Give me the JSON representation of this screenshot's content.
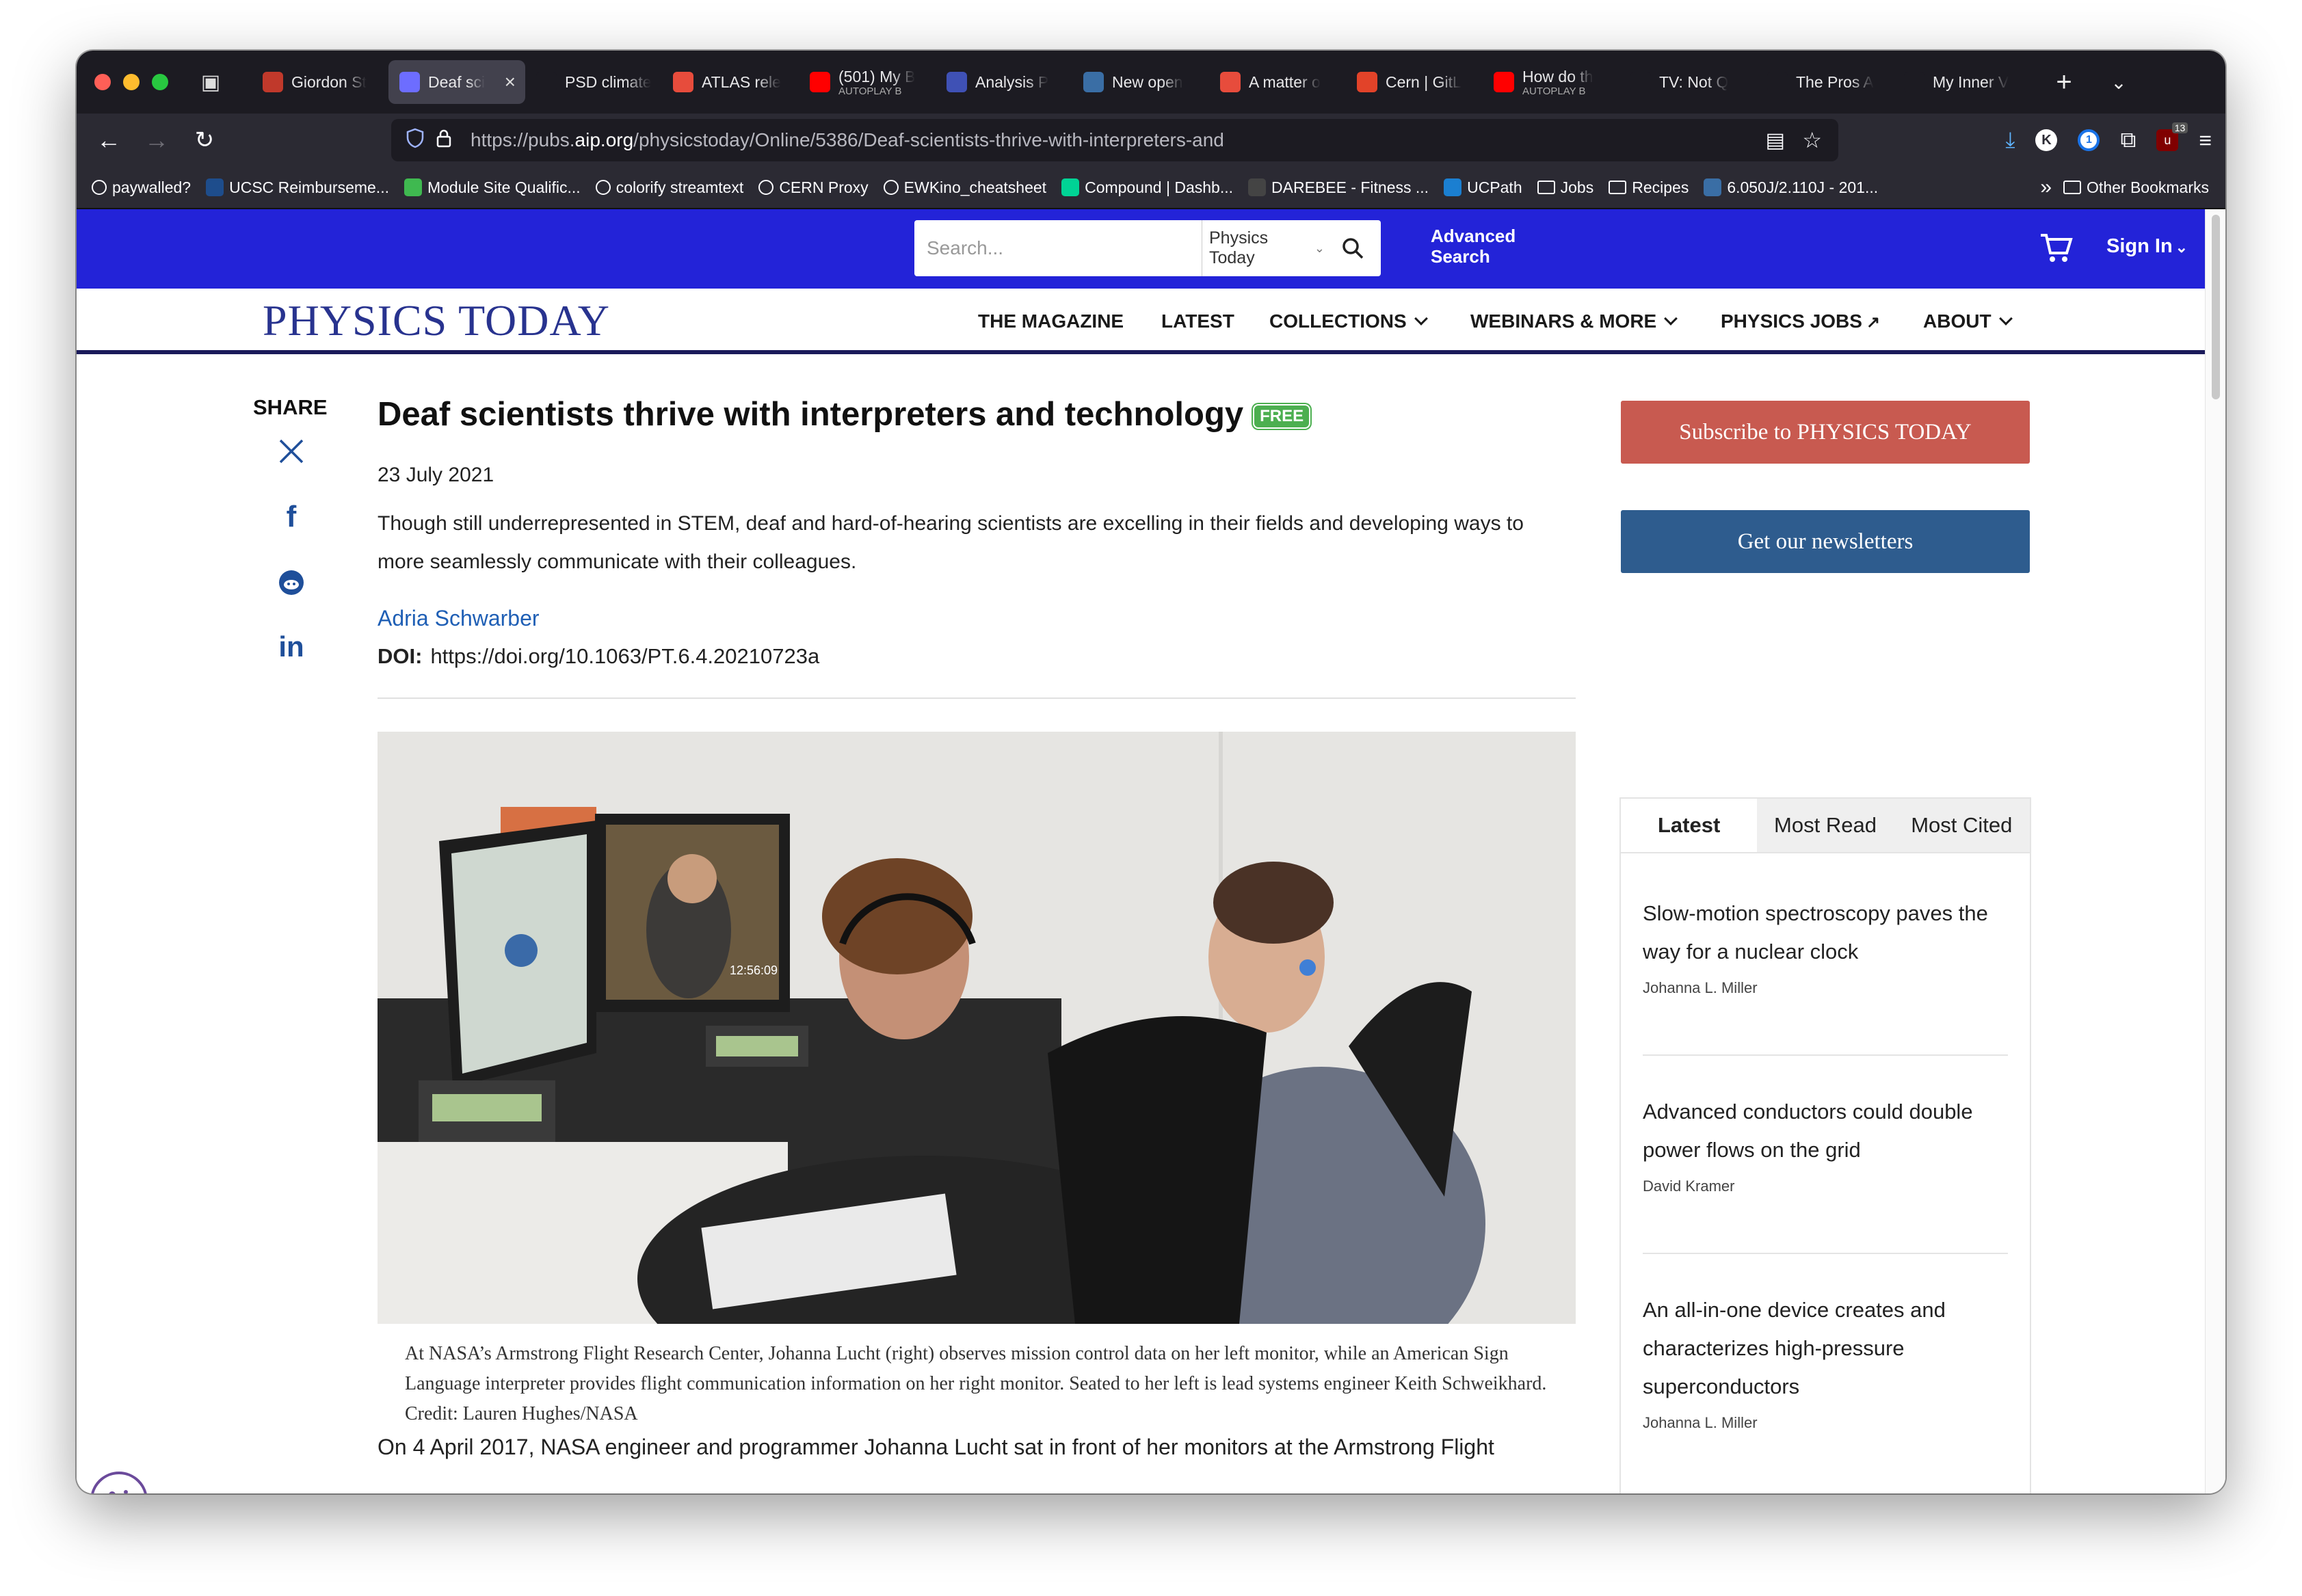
{
  "browser": {
    "tabs": [
      {
        "title": "Giordon St",
        "favicon": "ucsc-icon",
        "color": "#c0392b"
      },
      {
        "title": "Deaf sci",
        "favicon": "aip-icon",
        "color": "#6d6dff",
        "active": true
      },
      {
        "title": "PSD climate gr",
        "favicon": "none",
        "color": "#1c1b22"
      },
      {
        "title": "ATLAS rele",
        "favicon": "s-icon",
        "color": "#e74c3c"
      },
      {
        "title": "(501) My B",
        "sub": "AUTOPLAY B",
        "favicon": "youtube-icon",
        "color": "#ff0000"
      },
      {
        "title": "Analysis P",
        "favicon": "analysis-icon",
        "color": "#3f51b5"
      },
      {
        "title": "New open",
        "favicon": "fingerprint-icon",
        "color": "#3a6ea5"
      },
      {
        "title": "A matter o",
        "favicon": "s-icon",
        "color": "#e74c3c"
      },
      {
        "title": "Cern | GitL",
        "favicon": "gitlab-icon",
        "color": "#e24329"
      },
      {
        "title": "How do th",
        "sub": "AUTOPLAY B",
        "favicon": "youtube-icon",
        "color": "#ff0000"
      },
      {
        "title": "TV: Not Q",
        "favicon": "f-icon",
        "color": "#1c1b22"
      },
      {
        "title": "The Pros A",
        "favicon": "f-icon",
        "color": "#1c1b22"
      },
      {
        "title": "My Inner V",
        "favicon": "none",
        "color": "#1c1b22"
      }
    ],
    "url_prefix": "https://pubs.",
    "url_domain": "aip.org",
    "url_path": "/physicstoday/Online/5386/Deaf-scientists-thrive-with-interpreters-and",
    "extension_badge": "13",
    "bookmarks": [
      {
        "label": "paywalled?",
        "icon": "globe-icon"
      },
      {
        "label": "UCSC Reimburseme...",
        "icon": "ucsc-icon"
      },
      {
        "label": "Module Site Qualific...",
        "icon": "plus-icon"
      },
      {
        "label": "colorify streamtext",
        "icon": "globe-icon"
      },
      {
        "label": "CERN Proxy",
        "icon": "globe-icon"
      },
      {
        "label": "EWKino_cheatsheet",
        "icon": "cheatsheet-icon"
      },
      {
        "label": "Compound | Dashb...",
        "icon": "compound-icon"
      },
      {
        "label": "DAREBEE - Fitness ...",
        "icon": "darebee-icon"
      },
      {
        "label": "UCPath",
        "icon": "ucpath-icon"
      },
      {
        "label": "Jobs",
        "icon": "folder-icon"
      },
      {
        "label": "Recipes",
        "icon": "folder-icon"
      },
      {
        "label": "6.050J/2.110J - 201...",
        "icon": "mit-icon"
      }
    ],
    "other_bookmarks": "Other Bookmarks"
  },
  "site": {
    "search_placeholder": "Search...",
    "search_scope": "Physics Today",
    "advanced_search_line1": "Advanced",
    "advanced_search_line2": "Search",
    "sign_in": "Sign In",
    "logo": "PHYSICS TODAY",
    "nav": [
      "THE MAGAZINE",
      "LATEST",
      "COLLECTIONS",
      "WEBINARS & MORE",
      "PHYSICS JOBS",
      "ABOUT"
    ],
    "brand_color": "#2323d8"
  },
  "article": {
    "share_label": "SHARE",
    "title": "Deaf scientists thrive with interpreters and technology",
    "badge": "FREE",
    "date": "23 July 2021",
    "description": "Though still underrepresented in STEM, deaf and hard-of-hearing scientists are excelling in their fields and developing ways to more seamlessly communicate with their colleagues.",
    "author": "Adria Schwarber",
    "doi_label": "DOI:",
    "doi": "https://doi.org/10.1063/PT.6.4.20210723a",
    "photo_timestamp": "12:56:09",
    "caption": "At NASA’s Armstrong Flight Research Center, Johanna Lucht (right) observes mission control data on her left monitor, while an American Sign Language interpreter provides flight communication information on her right monitor. Seated to her left is lead systems engineer Keith Schweikhard. Credit: Lauren Hughes/NASA",
    "body_start": "On 4 April 2017, NASA engineer and programmer Johanna Lucht sat in front of her monitors at the Armstrong Flight"
  },
  "sidebar": {
    "subscribe": "Subscribe to PHYSICS TODAY",
    "newsletters": "Get our newsletters",
    "tabs": [
      "Latest",
      "Most Read",
      "Most Cited"
    ],
    "items": [
      {
        "title": "Slow-motion spectroscopy paves the way for a nuclear clock",
        "author": "Johanna L. Miller"
      },
      {
        "title": "Advanced conductors could double power flows on the grid",
        "author": "David Kramer"
      },
      {
        "title": "An all-in-one device creates and characterizes high-pressure superconductors",
        "author": "Johanna L. Miller"
      }
    ]
  }
}
